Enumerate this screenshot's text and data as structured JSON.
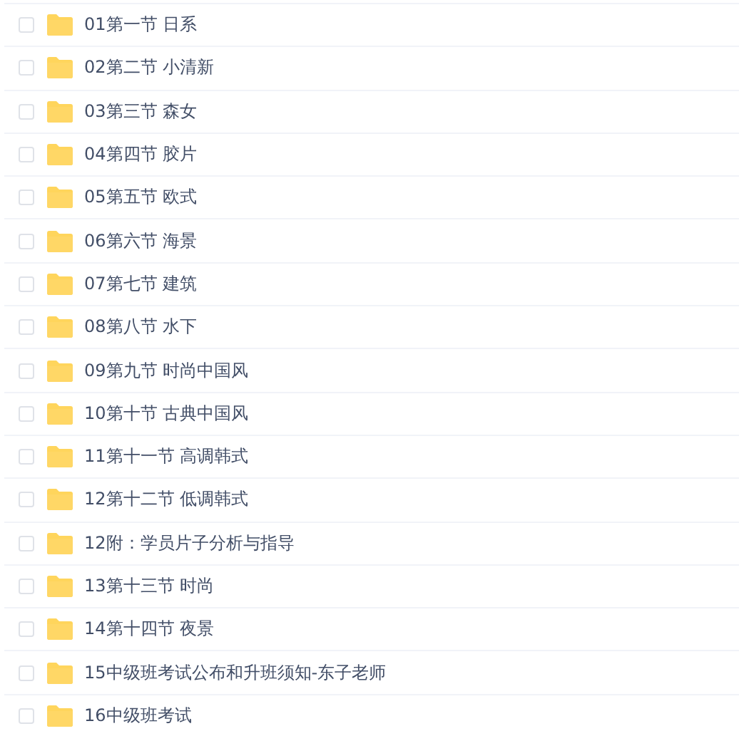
{
  "files": [
    {
      "name": "01第一节 日系",
      "checked": false
    },
    {
      "name": "02第二节 小清新",
      "checked": false
    },
    {
      "name": "03第三节 森女",
      "checked": false
    },
    {
      "name": "04第四节 胶片",
      "checked": false
    },
    {
      "name": "05第五节 欧式",
      "checked": false
    },
    {
      "name": "06第六节 海景",
      "checked": false
    },
    {
      "name": "07第七节 建筑",
      "checked": false
    },
    {
      "name": "08第八节 水下",
      "checked": false
    },
    {
      "name": "09第九节 时尚中国风",
      "checked": false
    },
    {
      "name": "10第十节 古典中国风",
      "checked": false
    },
    {
      "name": "11第十一节 高调韩式",
      "checked": false
    },
    {
      "name": "12第十二节 低调韩式",
      "checked": false
    },
    {
      "name": "12附：学员片子分析与指导",
      "checked": false
    },
    {
      "name": "13第十三节 时尚",
      "checked": false
    },
    {
      "name": "14第十四节 夜景",
      "checked": false
    },
    {
      "name": "15中级班考试公布和升班须知-东子老师",
      "checked": false
    },
    {
      "name": "16中级班考试",
      "checked": false
    }
  ]
}
